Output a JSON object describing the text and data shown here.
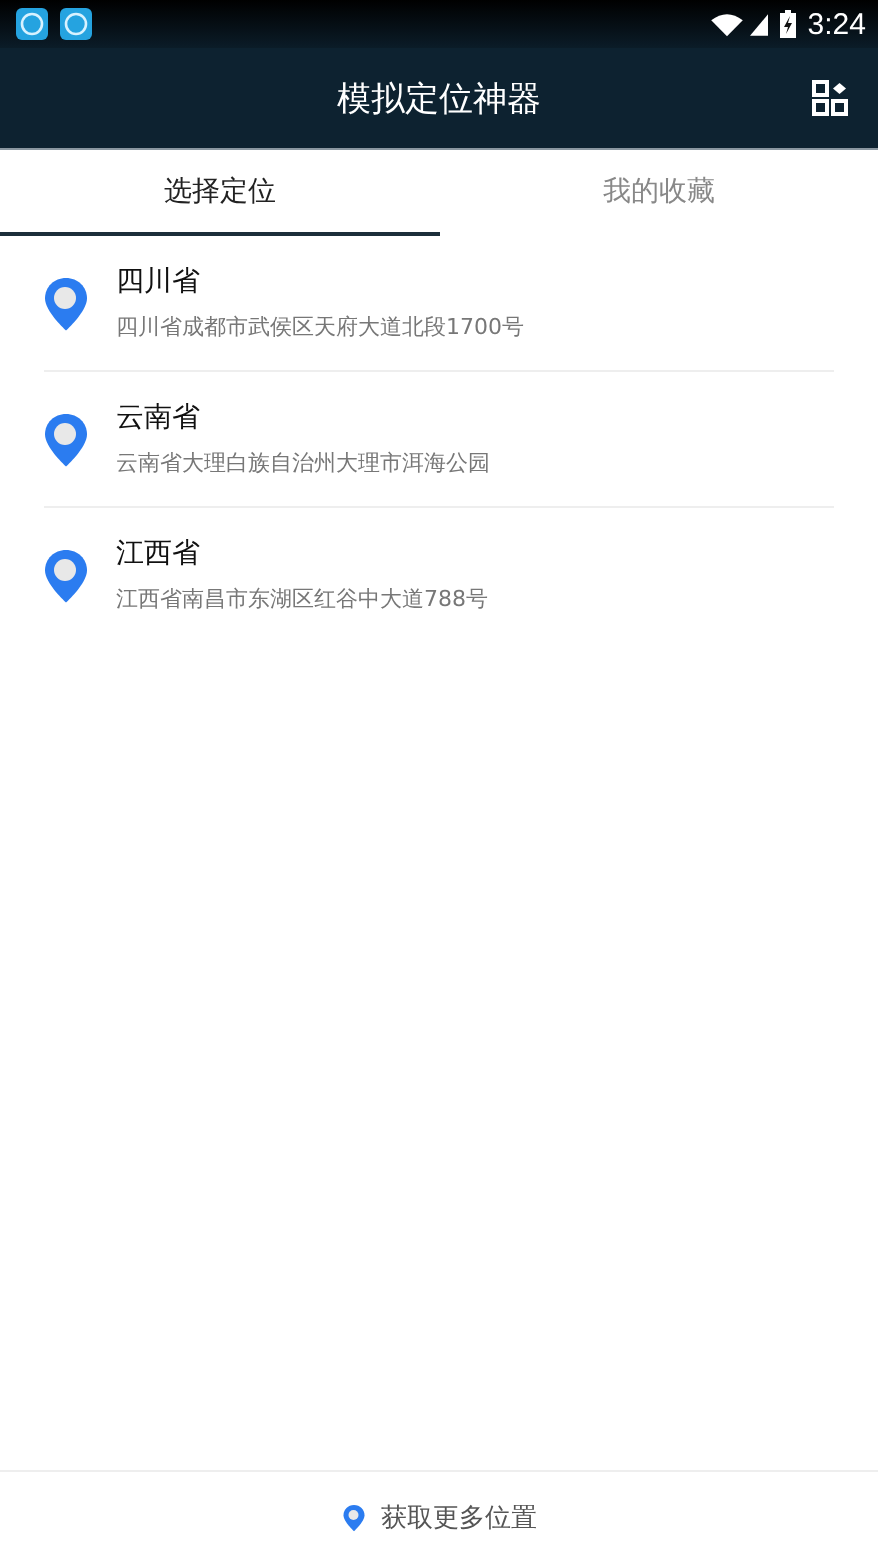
{
  "status_bar": {
    "time": "3:24"
  },
  "app_bar": {
    "title": "模拟定位神器"
  },
  "tabs": [
    {
      "label": "选择定位",
      "selected": true
    },
    {
      "label": "我的收藏",
      "selected": false
    }
  ],
  "locations": [
    {
      "name": "四川省",
      "address": "四川省成都市武侯区天府大道北段1700号"
    },
    {
      "name": "云南省",
      "address": "云南省大理白族自治州大理市洱海公园"
    },
    {
      "name": "江西省",
      "address": "江西省南昌市东湖区红谷中大道788号"
    }
  ],
  "footer": {
    "label": "获取更多位置"
  }
}
